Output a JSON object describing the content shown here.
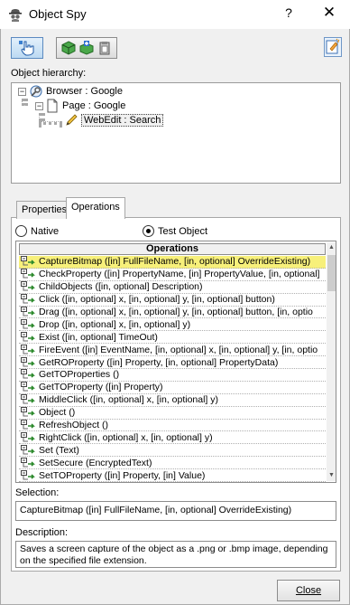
{
  "window": {
    "title": "Object Spy",
    "help_glyph": "?",
    "close_glyph": "✕"
  },
  "toolbar": {
    "icons": [
      "pointing-hand-icon",
      "add-object-icon",
      "add-all-objects-icon",
      "copy-clipboard-icon",
      "highlight-icon"
    ]
  },
  "hierarchy": {
    "label": "Object hierarchy:",
    "nodes": [
      {
        "label": "Browser : Google",
        "expander": "−"
      },
      {
        "label": "Page : Google",
        "expander": "−"
      },
      {
        "label": "WebEdit : Search"
      }
    ]
  },
  "tabs": [
    "Properties",
    "Operations"
  ],
  "active_tab": "Operations",
  "radios": {
    "native": "Native",
    "test_object": "Test Object",
    "selected": "Test Object"
  },
  "operations": {
    "header": "Operations",
    "rows": [
      "CaptureBitmap ([in] FullFileName, [in, optional] OverrideExisting)",
      "CheckProperty ([in] PropertyName, [in] PropertyValue, [in, optional]",
      "ChildObjects ([in, optional] Description)",
      "Click ([in, optional] x, [in, optional] y, [in, optional] button)",
      "Drag ([in, optional] x, [in, optional] y, [in, optional] button, [in, optio",
      "Drop ([in, optional] x, [in, optional] y)",
      "Exist ([in, optional] TimeOut)",
      "FireEvent ([in] EventName, [in, optional] x, [in, optional] y, [in, optio",
      "GetROProperty ([in] Property, [in, optional] PropertyData)",
      "GetTOProperties ()",
      "GetTOProperty ([in] Property)",
      "MiddleClick ([in, optional] x, [in, optional] y)",
      "Object ()",
      "RefreshObject ()",
      "RightClick ([in, optional] x, [in, optional] y)",
      "Set (Text)",
      "SetSecure (EncryptedText)",
      "SetTOProperty ([in] Property, [in] Value)"
    ],
    "selected_index": 0,
    "icon": "operation-icon",
    "highlight_color": "#f7f07a"
  },
  "selection": {
    "label": "Selection:",
    "value": "CaptureBitmap ([in] FullFileName, [in, optional] OverrideExisting)"
  },
  "description": {
    "label": "Description:",
    "value": "Saves a screen capture of the object as a .png or .bmp image, depending on the specified file extension."
  },
  "close_button": "Close"
}
